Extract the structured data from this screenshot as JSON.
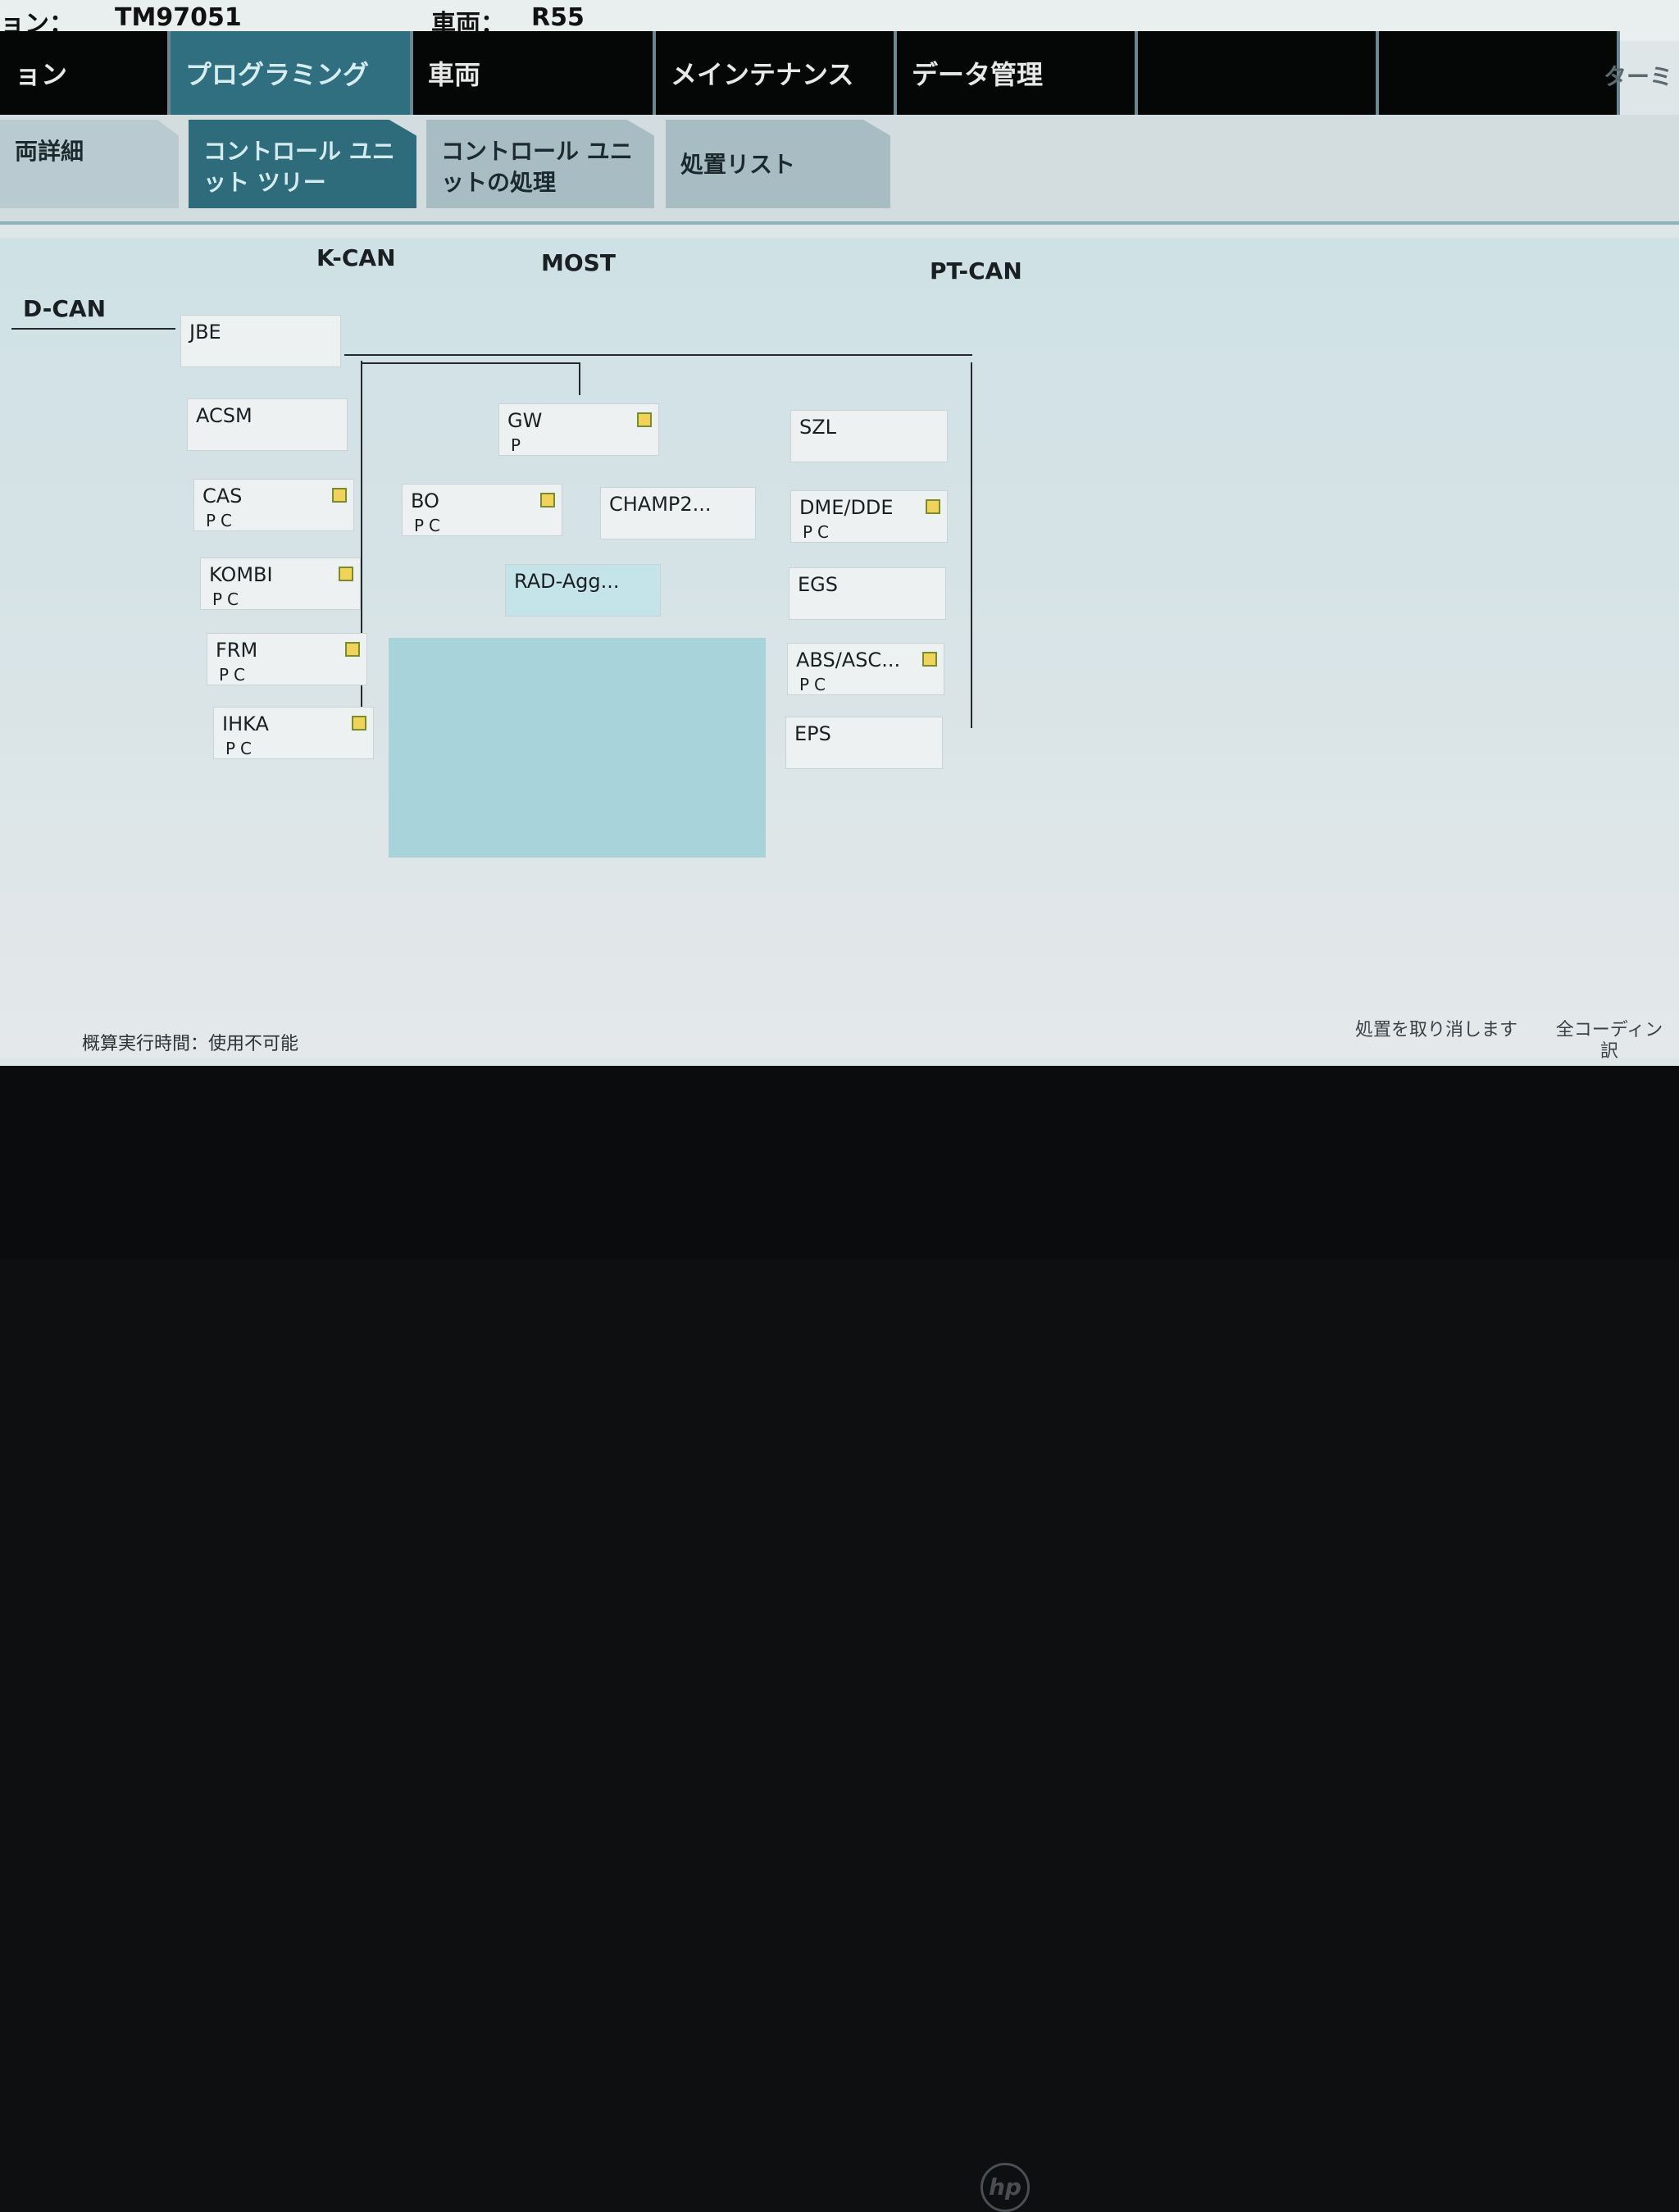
{
  "topbar": {
    "left_label": "ョン：",
    "id_value": "TM97051",
    "vehicle_label": "車両：",
    "vehicle_value": "R55"
  },
  "main_nav": {
    "tabs": [
      {
        "label": "ョン"
      },
      {
        "label": "プログラミング"
      },
      {
        "label": "車両"
      },
      {
        "label": "メインテナンス"
      },
      {
        "label": "データ管理"
      },
      {
        "label": ""
      },
      {
        "label": ""
      }
    ],
    "right_label": "ターミ"
  },
  "sub_nav": {
    "tabs": [
      {
        "label": "両詳細"
      },
      {
        "label": "コントロール ユニット ツリー"
      },
      {
        "label": "コントロール ユニットの処理"
      },
      {
        "label": "処置リスト"
      }
    ]
  },
  "buses": {
    "d_can": "D-CAN",
    "k_can": "K-CAN",
    "most": "MOST",
    "pt_can": "PT-CAN"
  },
  "units": {
    "jbe": {
      "name": "JBE",
      "state": ""
    },
    "acsm": {
      "name": "ACSM",
      "state": ""
    },
    "cas": {
      "name": "CAS",
      "state": "PC"
    },
    "kombi": {
      "name": "KOMBI",
      "state": "PC"
    },
    "frm": {
      "name": "FRM",
      "state": "PC"
    },
    "ihka": {
      "name": "IHKA",
      "state": "PC"
    },
    "gw": {
      "name": "GW",
      "state": "P"
    },
    "bo": {
      "name": "BO",
      "state": "PC"
    },
    "champ": {
      "name": "CHAMP2...",
      "state": ""
    },
    "rad": {
      "name": "RAD-Agg...",
      "state": ""
    },
    "szl": {
      "name": "SZL",
      "state": ""
    },
    "dme": {
      "name": "DME/DDE",
      "state": "PC"
    },
    "egs": {
      "name": "EGS",
      "state": ""
    },
    "abs": {
      "name": "ABS/ASC...",
      "state": "PC"
    },
    "eps": {
      "name": "EPS",
      "state": ""
    }
  },
  "status": {
    "text": "概算実行時間：使用不可能"
  },
  "actions": {
    "cancel": "処置を取り消します",
    "all_coding": "全コーディン訳"
  },
  "colors": {
    "active_tab": "#2f6f80",
    "nav_bg": "#050606",
    "most_area": "#a9d3db",
    "checkbox": "#f1d35a"
  },
  "icons": {
    "logo": "hp-logo-icon",
    "checkbox": "checkbox-icon"
  }
}
